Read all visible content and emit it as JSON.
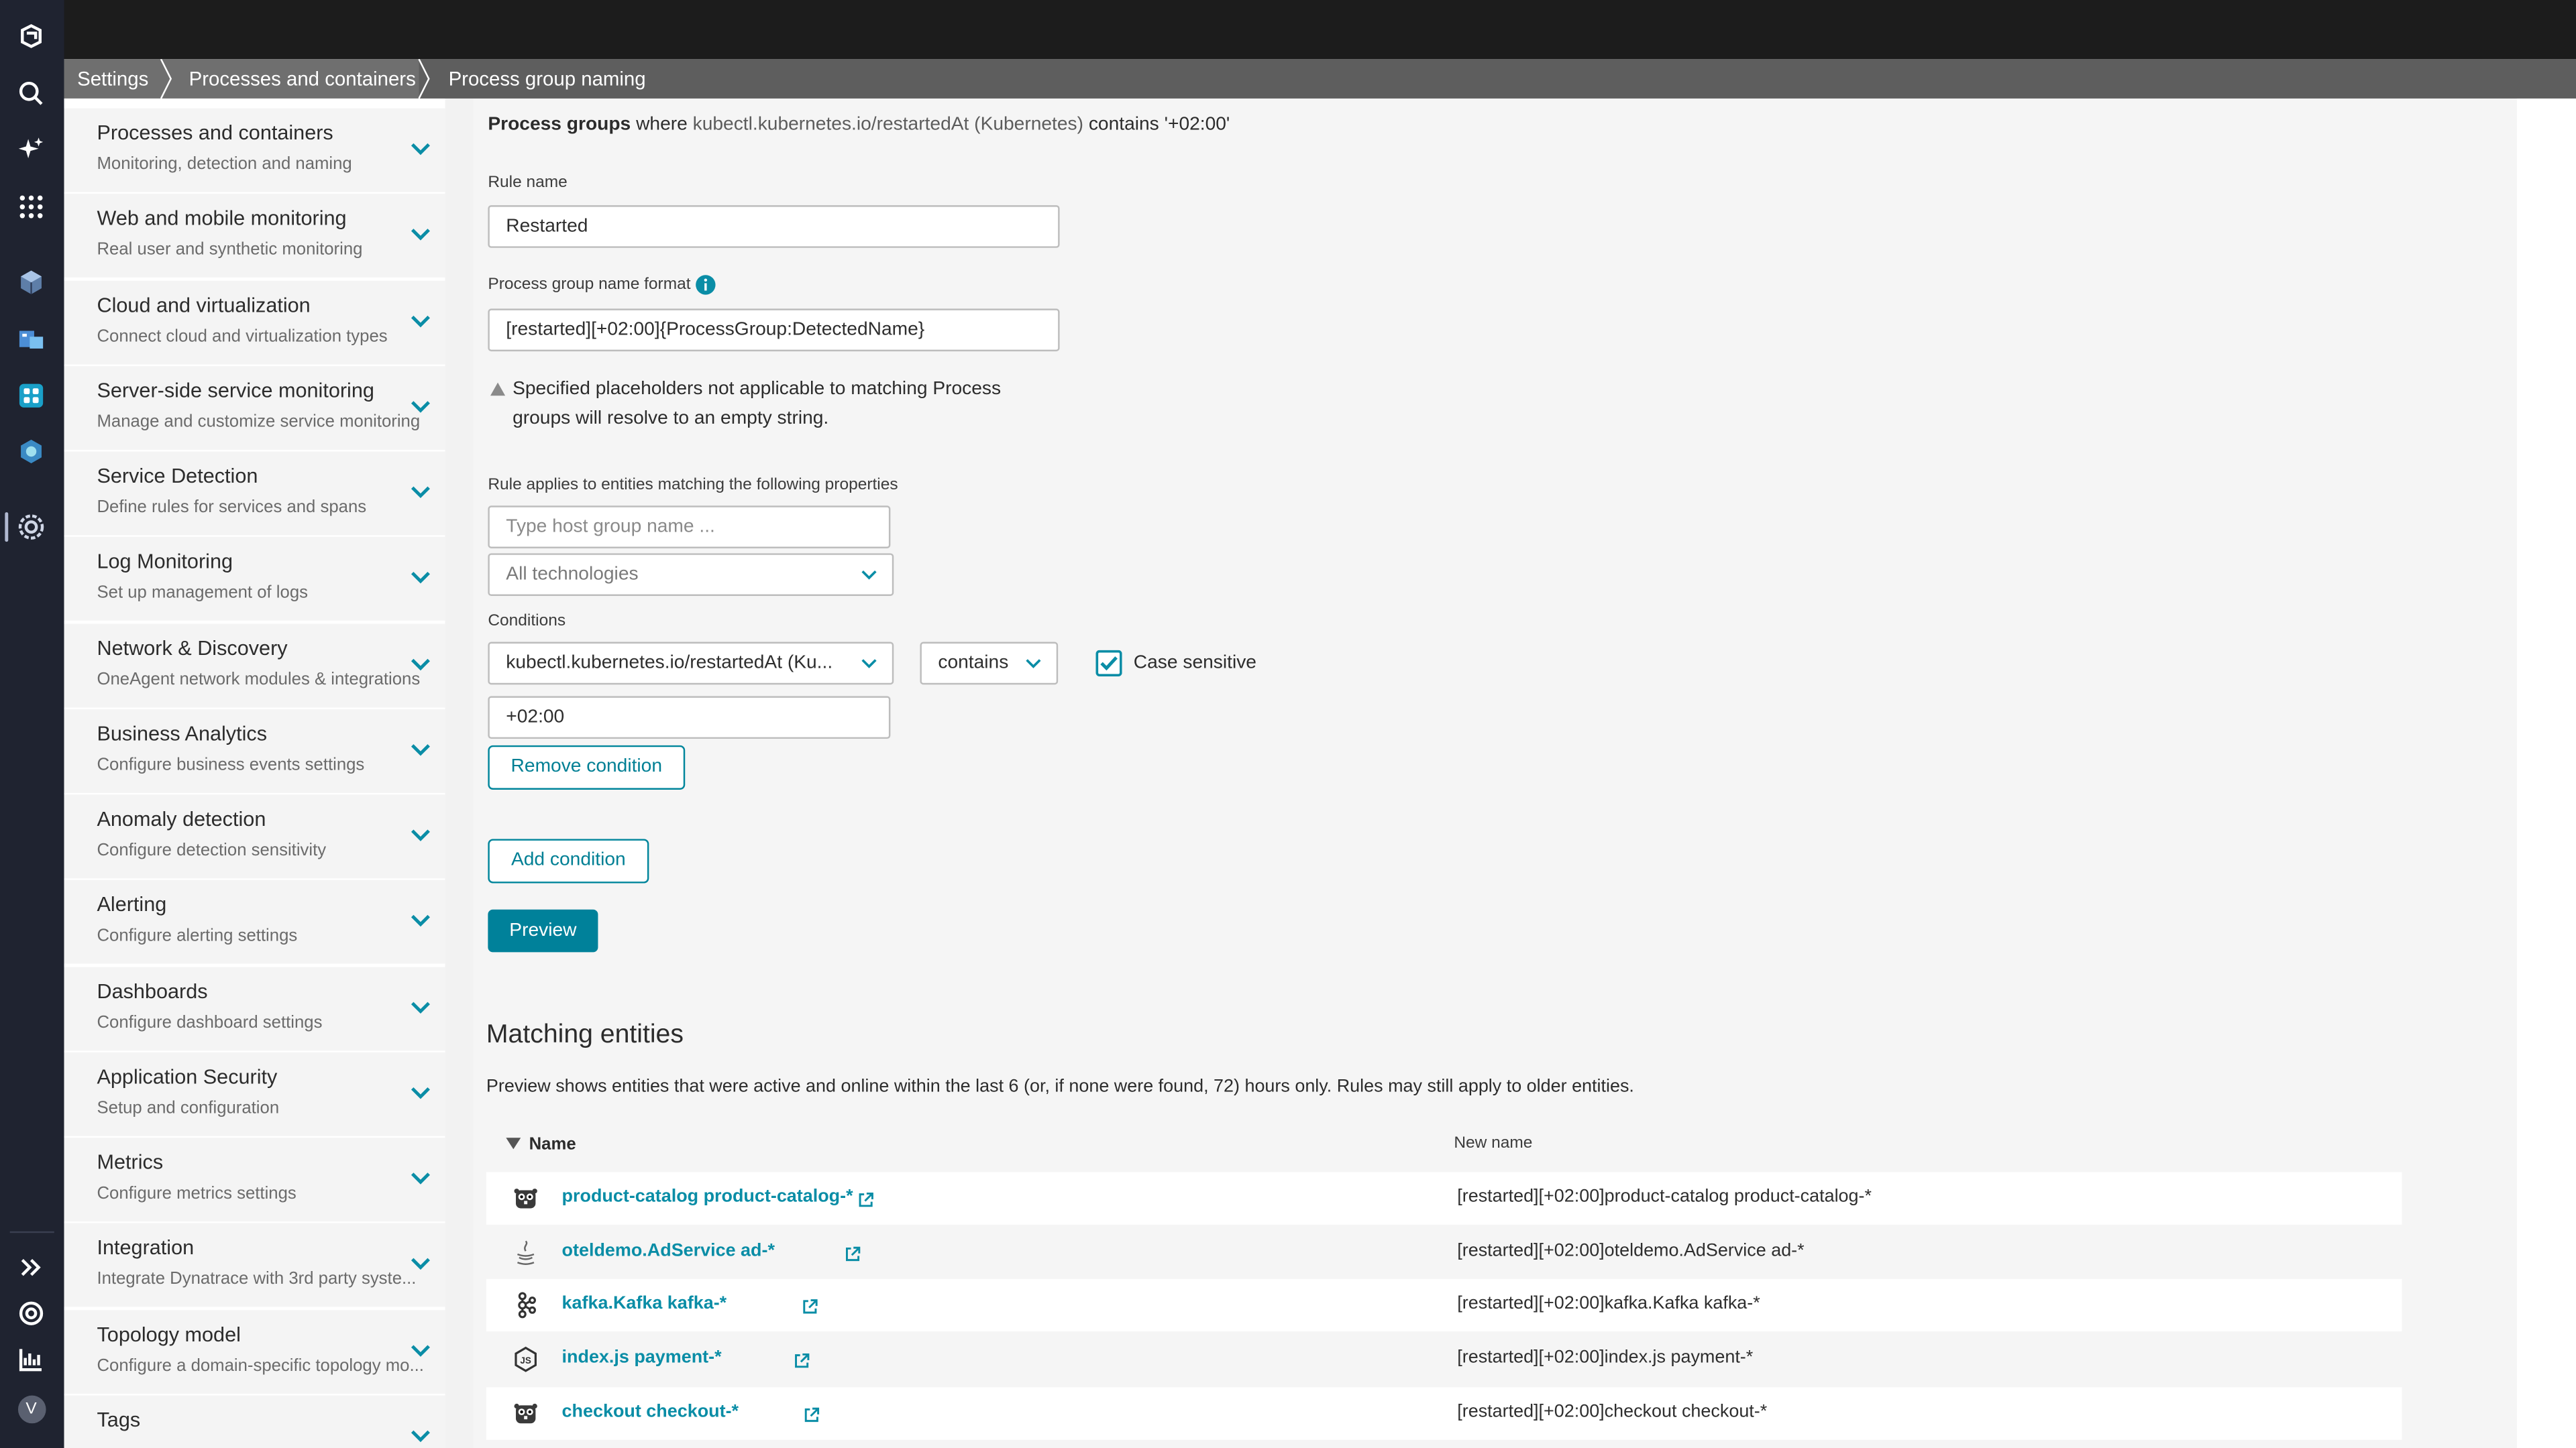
{
  "breadcrumb": {
    "items": [
      "Settings",
      "Processes and containers",
      "Process group naming"
    ]
  },
  "rail_icons": [
    "app-logo-icon",
    "search-icon",
    "sparkle-icon",
    "apps-grid-icon",
    "cube-icon",
    "infrastructure-icon",
    "dashboards-app-icon",
    "kubernetes-icon",
    "settings-icon",
    "expand-icon",
    "help-icon",
    "reports-icon",
    "user-avatar-icon"
  ],
  "user_initial": "V",
  "sidebar": {
    "items": [
      {
        "title": "Processes and containers",
        "subtitle": "Monitoring, detection and naming"
      },
      {
        "title": "Web and mobile monitoring",
        "subtitle": "Real user and synthetic monitoring"
      },
      {
        "title": "Cloud and virtualization",
        "subtitle": "Connect cloud and virtualization types"
      },
      {
        "title": "Server-side service monitoring",
        "subtitle": "Manage and customize service monitoring"
      },
      {
        "title": "Service Detection",
        "subtitle": "Define rules for services and spans"
      },
      {
        "title": "Log Monitoring",
        "subtitle": "Set up management of logs"
      },
      {
        "title": "Network & Discovery",
        "subtitle": "OneAgent network modules & integrations"
      },
      {
        "title": "Business Analytics",
        "subtitle": "Configure business events settings"
      },
      {
        "title": "Anomaly detection",
        "subtitle": "Configure detection sensitivity"
      },
      {
        "title": "Alerting",
        "subtitle": "Configure alerting settings"
      },
      {
        "title": "Dashboards",
        "subtitle": "Configure dashboard settings"
      },
      {
        "title": "Application Security",
        "subtitle": "Setup and configuration"
      },
      {
        "title": "Metrics",
        "subtitle": "Configure metrics settings"
      },
      {
        "title": "Integration",
        "subtitle": "Integrate Dynatrace with 3rd party syste..."
      },
      {
        "title": "Topology model",
        "subtitle": "Configure a domain-specific topology mo..."
      },
      {
        "title": "Tags",
        "subtitle": ""
      }
    ]
  },
  "rule": {
    "summary_entity": "Process groups",
    "summary_where": "where",
    "summary_property": "kubectl.kubernetes.io/restartedAt (Kubernetes)",
    "summary_op": "contains",
    "summary_value": "'+02:00'",
    "name_label": "Rule name",
    "name_value": "Restarted",
    "format_label": "Process group name format",
    "format_value": "[restarted][+02:00]{ProcessGroup:DetectedName}",
    "warning_line1": "Specified placeholders not applicable to matching Process",
    "warning_line2": "groups will resolve to an empty string.",
    "applies_label": "Rule applies to entities matching the following properties",
    "host_group_placeholder": "Type host group name ...",
    "technology_value": "All technologies",
    "conditions_label": "Conditions",
    "condition_property": "kubectl.kubernetes.io/restartedAt (Ku...",
    "condition_operator": "contains",
    "case_sensitive_label": "Case sensitive",
    "case_sensitive_checked": true,
    "condition_value": "+02:00",
    "remove_condition": "Remove condition",
    "add_condition": "Add condition",
    "preview": "Preview"
  },
  "matching": {
    "title": "Matching entities",
    "description": "Preview shows entities that were active and online within the last 6 (or, if none were found, 72) hours only. Rules may still apply to older entities.",
    "col_name": "Name",
    "col_new_name": "New name",
    "rows": [
      {
        "icon": "go-gopher-icon",
        "name": "product-catalog product-catalog-*",
        "new_name": "[restarted][+02:00]product-catalog product-catalog-*"
      },
      {
        "icon": "java-icon",
        "name": "oteldemo.AdService ad-*",
        "new_name": "[restarted][+02:00]oteldemo.AdService ad-*"
      },
      {
        "icon": "kafka-icon",
        "name": "kafka.Kafka kafka-*",
        "new_name": "[restarted][+02:00]kafka.Kafka kafka-*"
      },
      {
        "icon": "nodejs-icon",
        "name": "index.js payment-*",
        "new_name": "[restarted][+02:00]index.js payment-*"
      },
      {
        "icon": "go-gopher-icon",
        "name": "checkout checkout-*",
        "new_name": "[restarted][+02:00]checkout checkout-*"
      }
    ]
  },
  "colors": {
    "accent": "#00819a",
    "link": "#0a8da6",
    "rail": "#1f2330",
    "topbar": "#1c1c1c",
    "breadcrumb": "#6f6f6f"
  }
}
